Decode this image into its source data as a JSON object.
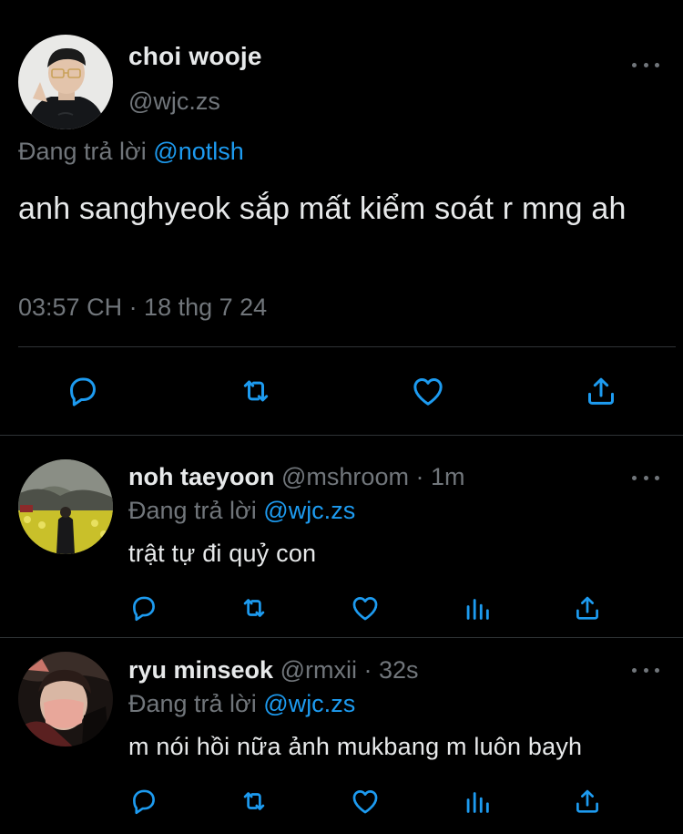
{
  "main_tweet": {
    "author_name": "choi wooje",
    "author_handle": "@wjc.zs",
    "replying_prefix": "Đang trả lời",
    "replying_to": "@notlsh",
    "text": "anh sanghyeok sắp mất kiểm soát r mng ah",
    "timestamp": "03:57 CH · 18 thg 7 24"
  },
  "replies": [
    {
      "author_name": "noh taeyoon",
      "author_handle": "@mshroom",
      "separator": "·",
      "time": "1m",
      "replying_prefix": "Đang trả lời",
      "replying_to": "@wjc.zs",
      "text": "trật tự đi quỷ con"
    },
    {
      "author_name": "ryu minseok",
      "author_handle": "@rmxii",
      "separator": "·",
      "time": "32s",
      "replying_prefix": "Đang trả lời",
      "replying_to": "@wjc.zs",
      "text": "m nói hồi nữa ảnh mukbang m luôn bayh"
    }
  ],
  "icons": {
    "reply": "comment-icon",
    "retweet": "retweet-icon",
    "like": "heart-icon",
    "views": "views-icon",
    "share": "share-icon",
    "more": "more-icon"
  },
  "colors": {
    "background": "#000000",
    "text_primary": "#e7e9ea",
    "text_secondary": "#71767b",
    "accent": "#1d9bf0",
    "divider": "#2f3336"
  }
}
